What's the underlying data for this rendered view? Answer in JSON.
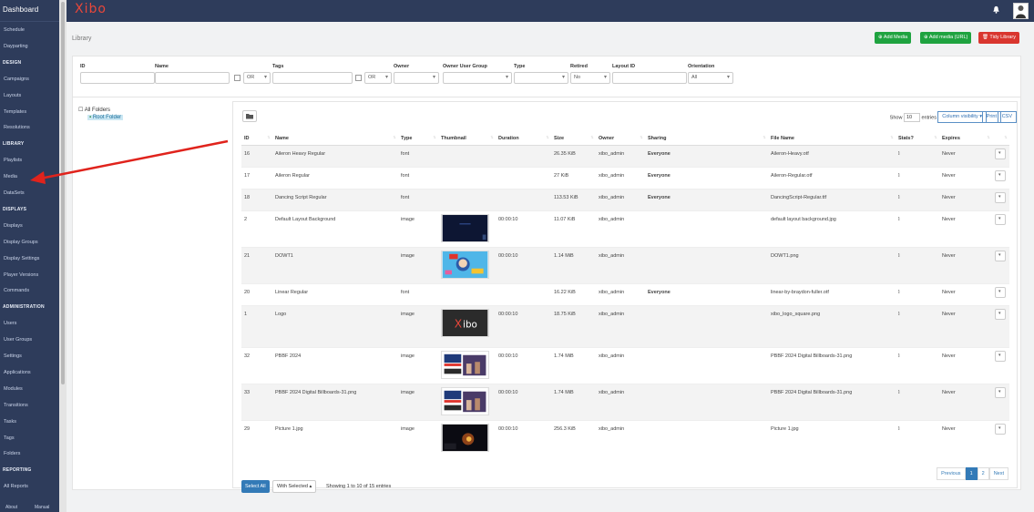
{
  "sidebar": {
    "brand": "Dashboard",
    "items": [
      {
        "type": "item",
        "label": "Schedule"
      },
      {
        "type": "item",
        "label": "Dayparting"
      },
      {
        "type": "head",
        "label": "DESIGN"
      },
      {
        "type": "item",
        "label": "Campaigns"
      },
      {
        "type": "item",
        "label": "Layouts"
      },
      {
        "type": "item",
        "label": "Templates"
      },
      {
        "type": "item",
        "label": "Resolutions"
      },
      {
        "type": "head",
        "label": "LIBRARY"
      },
      {
        "type": "item",
        "label": "Playlists"
      },
      {
        "type": "item",
        "label": "Media"
      },
      {
        "type": "item",
        "label": "DataSets"
      },
      {
        "type": "head",
        "label": "DISPLAYS"
      },
      {
        "type": "item",
        "label": "Displays"
      },
      {
        "type": "item",
        "label": "Display Groups"
      },
      {
        "type": "item",
        "label": "Display Settings"
      },
      {
        "type": "item",
        "label": "Player Versions"
      },
      {
        "type": "item",
        "label": "Commands"
      },
      {
        "type": "head",
        "label": "ADMINISTRATION"
      },
      {
        "type": "item",
        "label": "Users"
      },
      {
        "type": "item",
        "label": "User Groups"
      },
      {
        "type": "item",
        "label": "Settings"
      },
      {
        "type": "item",
        "label": "Applications"
      },
      {
        "type": "item",
        "label": "Modules"
      },
      {
        "type": "item",
        "label": "Transitions"
      },
      {
        "type": "item",
        "label": "Tasks"
      },
      {
        "type": "item",
        "label": "Tags"
      },
      {
        "type": "item",
        "label": "Folders"
      },
      {
        "type": "head",
        "label": "REPORTING"
      },
      {
        "type": "item",
        "label": "All Reports"
      }
    ],
    "footer_about": "About",
    "footer_manual": "Manual"
  },
  "topbar": {
    "logo": "Xibo"
  },
  "page": {
    "title": "Library",
    "add_media": "Add Media",
    "add_media_url": "Add media (URL)",
    "tidy_library": "Tidy Library"
  },
  "filters": {
    "id": "ID",
    "name": "Name",
    "tags": "Tags",
    "owner": "Owner",
    "owner_user_group": "Owner User Group",
    "type": "Type",
    "retired": "Retired",
    "layout_id": "Layout ID",
    "orientation": "Orientation",
    "or_value": "OR",
    "retired_value": "No",
    "orientation_value": "All"
  },
  "tree": {
    "all_folders": "All Folders",
    "root_folder": "Root Folder"
  },
  "table": {
    "show_label": "Show",
    "show_value": "10",
    "entries_label": "entries",
    "column_visibility": "Column visibility",
    "print": "Print",
    "csv": "CSV",
    "columns": [
      "ID",
      "Name",
      "Type",
      "Thumbnail",
      "Duration",
      "Size",
      "Owner",
      "Sharing",
      "File Name",
      "Stats?",
      "Expires"
    ],
    "rows": [
      {
        "id": "16",
        "name": "Aileron Heavy Regular",
        "type": "font",
        "thumb": "",
        "duration": "",
        "size": "26.35 KiB",
        "owner": "xibo_admin",
        "sharing": "Everyone",
        "file": "Aileron-Heavy.otf",
        "stats": "ʇ",
        "expires": "Never"
      },
      {
        "id": "17",
        "name": "Aileron Regular",
        "type": "font",
        "thumb": "",
        "duration": "",
        "size": "27 KiB",
        "owner": "xibo_admin",
        "sharing": "Everyone",
        "file": "Aileron-Regular.otf",
        "stats": "ʇ",
        "expires": "Never"
      },
      {
        "id": "18",
        "name": "Dancing Script Regular",
        "type": "font",
        "thumb": "",
        "duration": "",
        "size": "113.53 KiB",
        "owner": "xibo_admin",
        "sharing": "Everyone",
        "file": "DancingScript-Regular.ttf",
        "stats": "ʇ",
        "expires": "Never"
      },
      {
        "id": "2",
        "name": "Default Layout Background",
        "type": "image",
        "thumb": "bg",
        "duration": "00:00:10",
        "size": "11.07 KiB",
        "owner": "xibo_admin",
        "sharing": "",
        "file": "default layout background.jpg",
        "stats": "ʇ",
        "expires": "Never"
      },
      {
        "id": "21",
        "name": "DOWT1",
        "type": "image",
        "thumb": "train",
        "duration": "00:00:10",
        "size": "1.14 MiB",
        "owner": "xibo_admin",
        "sharing": "",
        "file": "DOWT1.png",
        "stats": "ʇ",
        "expires": "Never"
      },
      {
        "id": "20",
        "name": "Linear Regular",
        "type": "font",
        "thumb": "",
        "duration": "",
        "size": "16.22 KiB",
        "owner": "xibo_admin",
        "sharing": "Everyone",
        "file": "linear-by-braydon-fuller.otf",
        "stats": "ʇ",
        "expires": "Never"
      },
      {
        "id": "1",
        "name": "Logo",
        "type": "image",
        "thumb": "logo",
        "duration": "00:00:10",
        "size": "18.75 KiB",
        "owner": "xibo_admin",
        "sharing": "",
        "file": "xibo_logo_square.png",
        "stats": "ʇ",
        "expires": "Never"
      },
      {
        "id": "32",
        "name": "PBBF 2024",
        "type": "image",
        "thumb": "bb",
        "duration": "00:00:10",
        "size": "1.74 MiB",
        "owner": "xibo_admin",
        "sharing": "",
        "file": "PBBF 2024 Digital Billboards-31.png",
        "stats": "ʇ",
        "expires": "Never"
      },
      {
        "id": "33",
        "name": "PBBF 2024 Digital Billboards-31.png",
        "type": "image",
        "thumb": "bb",
        "duration": "00:00:10",
        "size": "1.74 MiB",
        "owner": "xibo_admin",
        "sharing": "",
        "file": "PBBF 2024 Digital Billboards-31.png",
        "stats": "ʇ",
        "expires": "Never"
      },
      {
        "id": "29",
        "name": "Picture 1.jpg",
        "type": "image",
        "thumb": "night",
        "duration": "00:00:10",
        "size": "256.3 KiB",
        "owner": "xibo_admin",
        "sharing": "",
        "file": "Picture 1.jpg",
        "stats": "ʇ",
        "expires": "Never"
      }
    ],
    "select_all": "Select All",
    "with_selected": "With Selected",
    "info": "Showing 1 to 10 of 15 entries",
    "pagination": [
      "Previous",
      "1",
      "2",
      "Next"
    ]
  },
  "colors": {
    "sidebar": "#2e3c5b",
    "success": "#1fa340",
    "danger": "#d9362f",
    "primary": "#337ab7",
    "arrow": "#e0231c"
  }
}
